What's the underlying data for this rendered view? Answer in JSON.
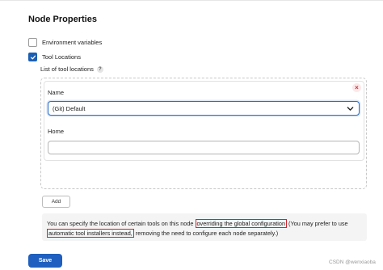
{
  "section": {
    "title": "Node Properties"
  },
  "options": [
    {
      "label": "Environment variables",
      "checked": false
    },
    {
      "label": "Tool Locations",
      "checked": true
    }
  ],
  "tool_locations": {
    "list_label": "List of tool locations",
    "help_icon": "?",
    "remove_icon": "×",
    "name_label": "Name",
    "name_value": "(Git) Default",
    "home_label": "Home",
    "home_value": "",
    "add_label": "Add"
  },
  "info": {
    "part1": "You can specify the location of certain tools on this node ",
    "highlight1": "overriding the global configuration",
    "part2": " (You may prefer to use ",
    "highlight2": "automatic tool installers instead,",
    "part3": " removing the need to configure each node separately.)"
  },
  "save_label": "Save",
  "watermark": "CSDN @wenxiaoba",
  "colors": {
    "primary": "#1f5fbf",
    "highlight_border": "#d3232f",
    "checked": "#1b5fb4"
  }
}
